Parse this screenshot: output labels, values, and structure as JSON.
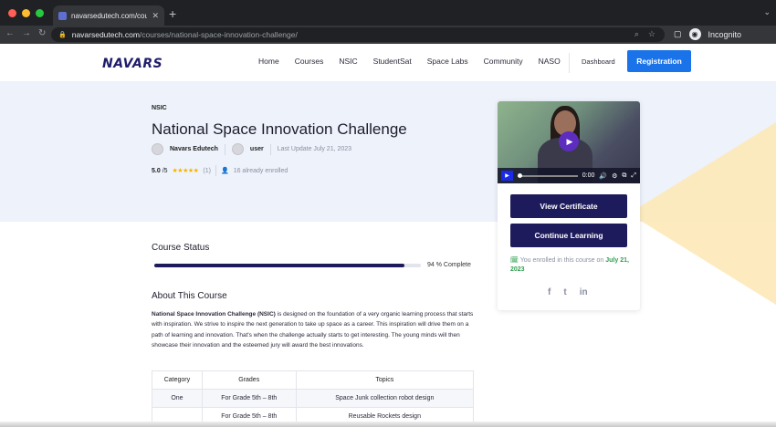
{
  "browser": {
    "tab_title": "navarsedutech.com/courses/n",
    "url_host": "navarsedutech.com",
    "url_path": "/courses/national-space-innovation-challenge/",
    "profile_label": "Incognito",
    "dot_colors": [
      "#ff5f57",
      "#febc2e",
      "#28c840"
    ]
  },
  "header": {
    "logo": "NAVARS",
    "nav": [
      "Home",
      "Courses",
      "NSIC",
      "StudentSat",
      "Space Labs",
      "Community",
      "NASO"
    ],
    "dashboard": "Dashboard",
    "registration": "Registration"
  },
  "course": {
    "category": "NSIC",
    "title": "National Space Innovation Challenge",
    "author": "Navars Edutech",
    "user": "user",
    "last_update": "Last Update July 21, 2023",
    "rating": "5.0",
    "rating_max": "/5",
    "rating_count": "(1)",
    "enrolled_count": "16 already enrolled"
  },
  "sidebar": {
    "video_time": "0:00",
    "view_certificate": "View Certificate",
    "continue_learning": "Continue Learning",
    "enrolled_prefix": "You enrolled in this course on",
    "enrolled_date": "July 21, 2023",
    "social": [
      "f",
      "t",
      "in"
    ]
  },
  "status": {
    "title": "Course Status",
    "percent": 94,
    "label": "94 % Complete"
  },
  "about": {
    "title": "About This Course",
    "lead": "National Space Innovation Challenge",
    "lead_abbr": "(NSIC)",
    "body": " is designed on the foundation of a very organic learning process that starts with inspiration. We strive to inspire the next generation to take up space as a career. This inspiration will drive them on a path of learning and innovation. That's when the challenge actually starts to get interesting. The young minds will then showcase their innovation and the esteemed jury will award the best innovations."
  },
  "table": {
    "headers": [
      "Category",
      "Grades",
      "Topics"
    ],
    "rows": [
      [
        "One",
        "For Grade 5th – 8th",
        "Space Junk collection robot design"
      ],
      [
        "",
        "For Grade 5th – 8th",
        "Reusable Rockets design"
      ]
    ]
  }
}
